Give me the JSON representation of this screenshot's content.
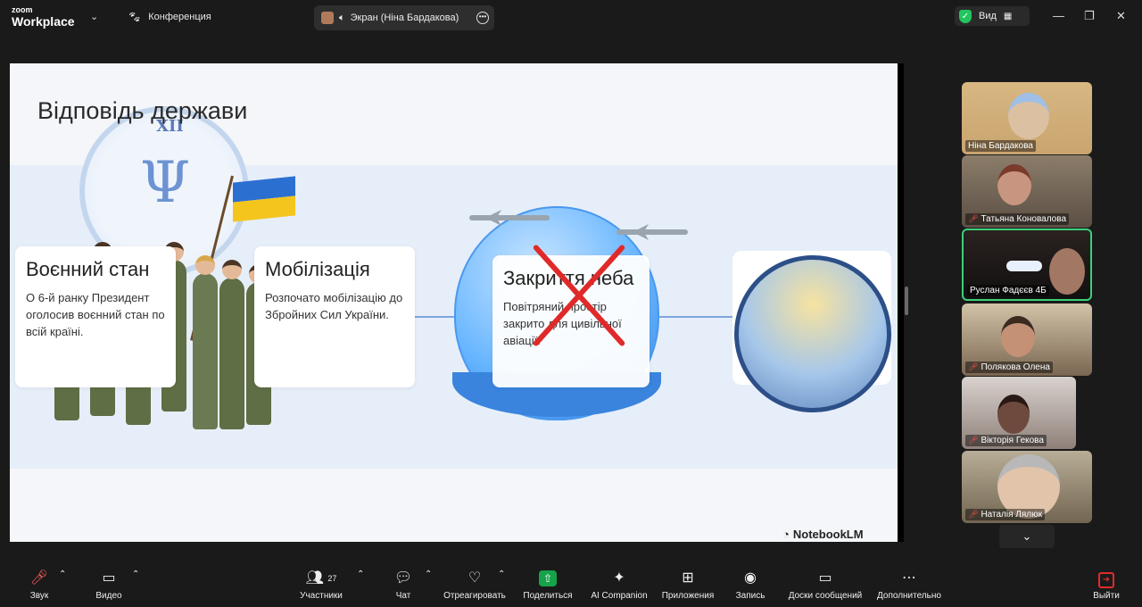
{
  "app": {
    "logo_top": "zoom",
    "logo_bottom": "Workplace"
  },
  "topbar": {
    "meeting_label": "Конференция",
    "share_label": "Экран (Ніна Бардакова)",
    "view_label": "Вид",
    "window_min": "—",
    "window_restore": "❐",
    "window_close": "✕"
  },
  "slide": {
    "title": "Відповідь держави",
    "clock_numeral": "XII",
    "cards": [
      {
        "title": "Воєнний стан",
        "text": "О 6-й ранку Президент оголосив воєнний стан по всій країні."
      },
      {
        "title": "Мобілізація",
        "text": "Розпочато мобілізацію до Збройних Сил України."
      },
      {
        "title": "Закриття неба",
        "text": "Повітряний простір закрито для цивільної авіації."
      }
    ],
    "brand": "NotebookLM"
  },
  "participants": [
    {
      "name": "Ніна Бардакова",
      "muted": false,
      "active": false
    },
    {
      "name": "Татьяна Коновалова",
      "muted": true,
      "active": false
    },
    {
      "name": "Руслан Фадєєв 4Б",
      "muted": false,
      "active": true
    },
    {
      "name": "Полякова Олена",
      "muted": true,
      "active": false
    },
    {
      "name": "Вікторія Гекова",
      "muted": true,
      "active": false
    },
    {
      "name": "Наталія Лялюк",
      "muted": true,
      "active": false
    }
  ],
  "toolbar": {
    "audio": "Звук",
    "video": "Видео",
    "participants": "Участники",
    "participants_count": "27",
    "chat": "Чат",
    "react": "Отреагировать",
    "share": "Поделиться",
    "companion": "AI Companion",
    "apps": "Приложения",
    "record": "Запись",
    "whiteboards": "Доски сообщений",
    "more": "Дополнительно",
    "leave": "Выйти"
  },
  "colors": {
    "accent_green": "#16a34a",
    "active_border": "#3cd07a",
    "leave_red": "#e02a2a"
  }
}
